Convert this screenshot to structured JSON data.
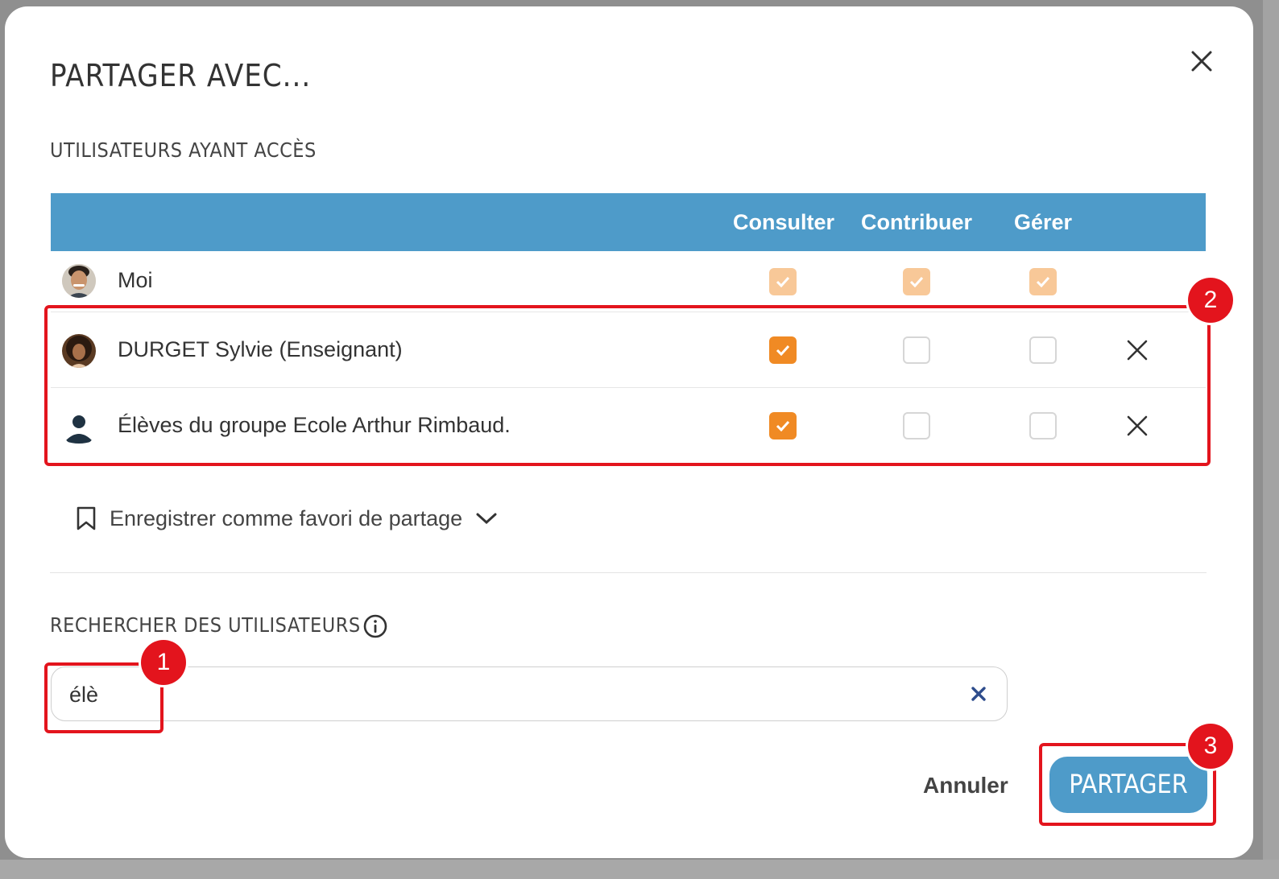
{
  "dialog": {
    "title": "PARTAGER AVEC...",
    "access_section_title": "UTILISATEURS AYANT ACCÈS",
    "search_section_title": "RECHERCHER DES UTILISATEURS",
    "info_icon": "info-icon",
    "close_icon": "close-icon"
  },
  "table": {
    "columns": [
      "Consulter",
      "Contribuer",
      "Gérer"
    ],
    "rows": [
      {
        "name": "Moi",
        "avatar": "user-photo",
        "consulter": true,
        "contribuer": true,
        "gerer": true,
        "locked": true
      },
      {
        "name": "DURGET Sylvie (Enseignant)",
        "avatar": "user-photo",
        "consulter": true,
        "contribuer": false,
        "gerer": false,
        "locked": false
      },
      {
        "name": "Élèves du groupe Ecole Arthur Rimbaud.",
        "avatar": "group-icon",
        "consulter": true,
        "contribuer": false,
        "gerer": false,
        "locked": false
      }
    ]
  },
  "favorite": {
    "label": "Enregistrer comme favori de partage",
    "icon": "bookmark-icon",
    "chevron": "chevron-down-icon"
  },
  "search": {
    "value": "élè",
    "placeholder": ""
  },
  "actions": {
    "cancel_label": "Annuler",
    "share_label": "PARTAGER"
  },
  "annotations": [
    "1",
    "2",
    "3"
  ],
  "colors": {
    "header": "#4e9bc9",
    "checked": "#f08a24",
    "checked_locked": "#f8c898",
    "annotation": "#e3141d"
  }
}
